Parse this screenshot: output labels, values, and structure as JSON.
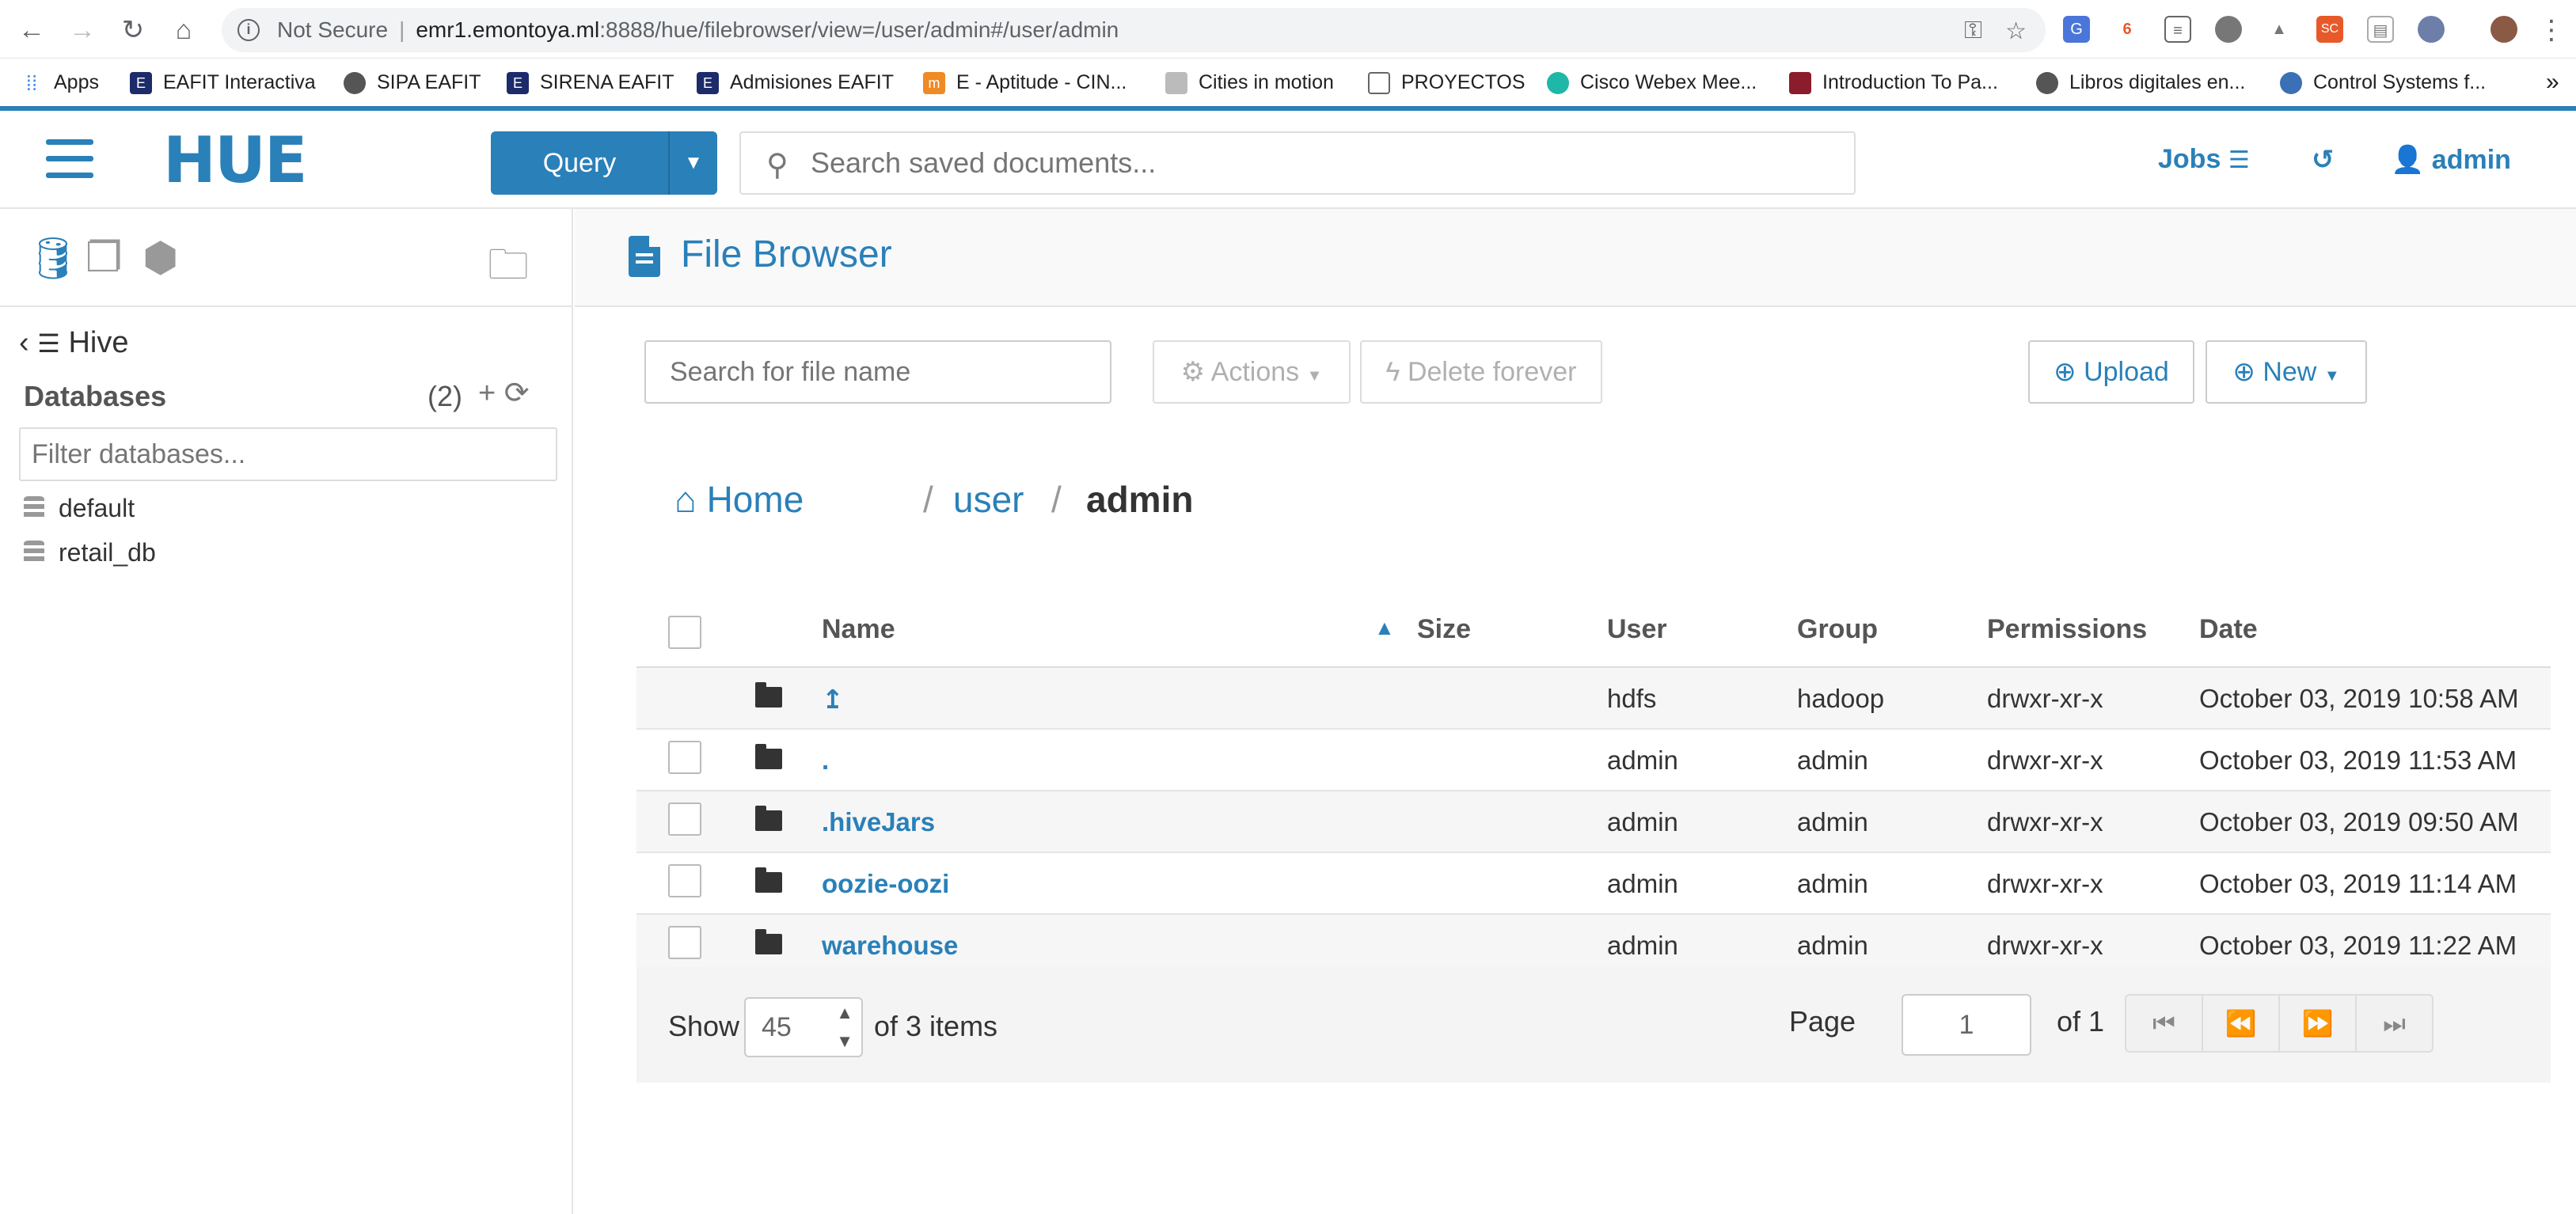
{
  "browser": {
    "security_label": "Not Secure",
    "url_host": "emr1.emontoya.ml",
    "url_rest": ":8888/hue/filebrowser/view=/user/admin#/user/admin"
  },
  "bookmarks": [
    {
      "label": "Apps",
      "icon": "apps-grid-icon",
      "color": "#4285f4"
    },
    {
      "label": "EAFIT Interactiva",
      "icon": "eafit-icon",
      "color": "#1d2b6b"
    },
    {
      "label": "SIPA EAFIT",
      "icon": "globe-icon",
      "color": "#555555"
    },
    {
      "label": "SIRENA EAFIT",
      "icon": "eafit-icon",
      "color": "#1d2b6b"
    },
    {
      "label": "Admisiones EAFIT",
      "icon": "eafit-icon",
      "color": "#1d2b6b"
    },
    {
      "label": "E - Aptitude - CIN...",
      "icon": "moodle-icon",
      "color": "#f08a24"
    },
    {
      "label": "Cities in motion",
      "icon": "chart-icon",
      "color": "#888888"
    },
    {
      "label": "PROYECTOS",
      "icon": "folder-icon",
      "color": "#666666"
    },
    {
      "label": "Cisco Webex Mee...",
      "icon": "webex-icon",
      "color": "#1eb7a8"
    },
    {
      "label": "Introduction To Pa...",
      "icon": "crest-icon",
      "color": "#8b1c2b"
    },
    {
      "label": "Libros digitales en...",
      "icon": "globe-icon",
      "color": "#555555"
    },
    {
      "label": "Control Systems f...",
      "icon": "eye-icon",
      "color": "#3b6fb6"
    }
  ],
  "header": {
    "logo_text": "HUE",
    "query_label": "Query",
    "search_placeholder": "Search saved documents...",
    "jobs_label": "Jobs",
    "user_label": "admin"
  },
  "left_panel": {
    "source_title": "Hive",
    "databases_title": "Databases",
    "databases_count": "(2)",
    "filter_placeholder": "Filter databases...",
    "databases": [
      "default",
      "retail_db"
    ]
  },
  "main": {
    "title": "File Browser",
    "file_search_placeholder": "Search for file name",
    "actions_label": "Actions",
    "delete_label": "Delete forever",
    "upload_label": "Upload",
    "new_label": "New",
    "breadcrumb": {
      "home": "Home",
      "sep1": "/",
      "user": "user",
      "sep2": "/",
      "current": "admin"
    },
    "columns": [
      "Name",
      "Size",
      "User",
      "Group",
      "Permissions",
      "Date"
    ],
    "rows": [
      {
        "name": "↥",
        "size": "",
        "user": "hdfs",
        "group": "hadoop",
        "permissions": "drwxr-xr-x",
        "date": "October 03, 2019 10:58 AM"
      },
      {
        "name": ".",
        "size": "",
        "user": "admin",
        "group": "admin",
        "permissions": "drwxr-xr-x",
        "date": "October 03, 2019 11:53 AM"
      },
      {
        "name": ".hiveJars",
        "size": "",
        "user": "admin",
        "group": "admin",
        "permissions": "drwxr-xr-x",
        "date": "October 03, 2019 09:50 AM"
      },
      {
        "name": "oozie-oozi",
        "size": "",
        "user": "admin",
        "group": "admin",
        "permissions": "drwxr-xr-x",
        "date": "October 03, 2019 11:14 AM"
      },
      {
        "name": "warehouse",
        "size": "",
        "user": "admin",
        "group": "admin",
        "permissions": "drwxr-xr-x",
        "date": "October 03, 2019 11:22 AM"
      }
    ],
    "footer": {
      "show_label": "Show",
      "page_size": "45",
      "items_text": "of 3 items",
      "page_label": "Page",
      "page_value": "1",
      "page_of": "of 1"
    }
  },
  "colors": {
    "accent": "#2a80b9"
  }
}
